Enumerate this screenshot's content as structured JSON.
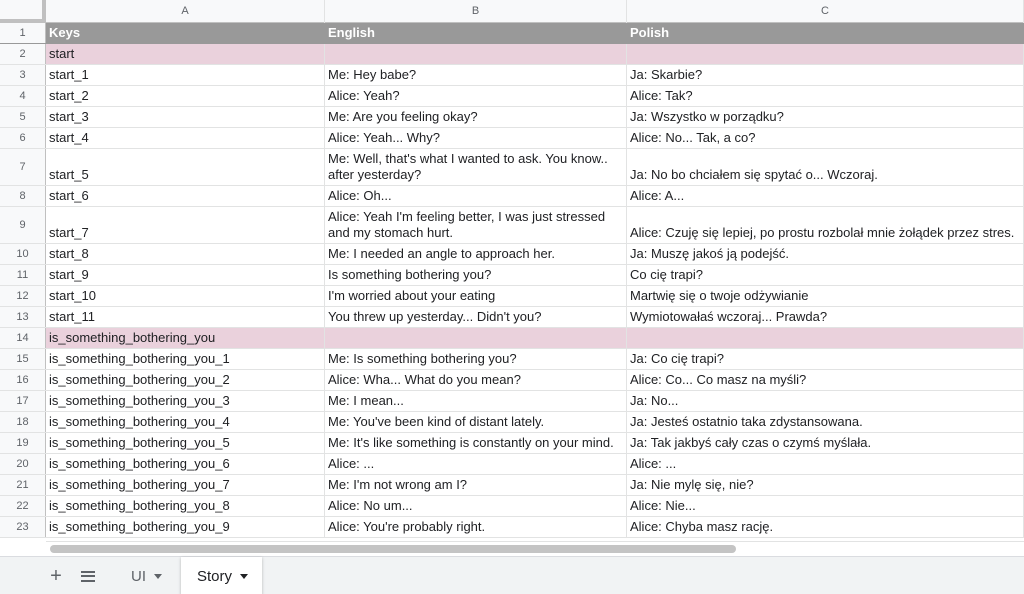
{
  "columns": [
    "A",
    "B",
    "C"
  ],
  "rows": [
    {
      "num": "1",
      "key": "Keys",
      "english": "English",
      "polish": "Polish",
      "type": "header"
    },
    {
      "num": "2",
      "key": "start",
      "english": "",
      "polish": "",
      "type": "section"
    },
    {
      "num": "3",
      "key": "start_1",
      "english": "Me: Hey babe?",
      "polish": "Ja: Skarbie?"
    },
    {
      "num": "4",
      "key": "start_2",
      "english": "Alice: Yeah?",
      "polish": "Alice: Tak?"
    },
    {
      "num": "5",
      "key": "start_3",
      "english": "Me: Are you feeling okay?",
      "polish": "Ja: Wszystko w porządku?"
    },
    {
      "num": "6",
      "key": "start_4",
      "english": "Alice: Yeah... Why?",
      "polish": "Alice: No... Tak, a co?"
    },
    {
      "num": "7",
      "key": "start_5",
      "english": "Me: Well, that's what I wanted to ask. You know.. after yesterday?",
      "polish": "Ja: No bo chciałem się spytać o... Wczoraj.",
      "tall": true
    },
    {
      "num": "8",
      "key": "start_6",
      "english": "Alice: Oh...",
      "polish": "Alice: A..."
    },
    {
      "num": "9",
      "key": "start_7",
      "english": "Alice: Yeah I'm feeling better, I was just stressed and my stomach hurt.",
      "polish": "Alice: Czuję się lepiej, po prostu rozbolał mnie żołądek przez stres.",
      "tall": true
    },
    {
      "num": "10",
      "key": "start_8",
      "english": "Me: I needed an angle to approach her.",
      "polish": "Ja: Muszę jakoś ją podejść."
    },
    {
      "num": "11",
      "key": "start_9",
      "english": "Is something bothering you?",
      "polish": "Co cię trapi?"
    },
    {
      "num": "12",
      "key": "start_10",
      "english": "I'm worried about your eating",
      "polish": "Martwię się o twoje odżywianie"
    },
    {
      "num": "13",
      "key": "start_11",
      "english": "You threw up yesterday... Didn't you?",
      "polish": "Wymiotowałaś wczoraj... Prawda?"
    },
    {
      "num": "14",
      "key": "is_something_bothering_you",
      "english": "",
      "polish": "",
      "type": "section"
    },
    {
      "num": "15",
      "key": "is_something_bothering_you_1",
      "english": "Me: Is something bothering you?",
      "polish": "Ja: Co cię trapi?"
    },
    {
      "num": "16",
      "key": "is_something_bothering_you_2",
      "english": "Alice: Wha... What do you mean?",
      "polish": "Alice: Co... Co masz na myśli?"
    },
    {
      "num": "17",
      "key": "is_something_bothering_you_3",
      "english": "Me: I mean...",
      "polish": "Ja: No..."
    },
    {
      "num": "18",
      "key": "is_something_bothering_you_4",
      "english": "Me: You've been kind of distant lately.",
      "polish": "Ja: Jesteś ostatnio taka zdystansowana."
    },
    {
      "num": "19",
      "key": "is_something_bothering_you_5",
      "english": "Me: It's like something is constantly on your mind.",
      "polish": "Ja: Tak jakbyś cały czas o czymś myślała."
    },
    {
      "num": "20",
      "key": "is_something_bothering_you_6",
      "english": "Alice: ...",
      "polish": "Alice: ..."
    },
    {
      "num": "21",
      "key": "is_something_bothering_you_7",
      "english": "Me: I'm not wrong am I?",
      "polish": "Ja: Nie mylę się, nie?"
    },
    {
      "num": "22",
      "key": "is_something_bothering_you_8",
      "english": "Alice: No um...",
      "polish": "Alice: Nie..."
    },
    {
      "num": "23",
      "key": "is_something_bothering_you_9",
      "english": "Alice: You're probably right.",
      "polish": "Alice: Chyba masz rację."
    }
  ],
  "tabs": {
    "add_icon": "+",
    "sheets": [
      {
        "label": "UI",
        "active": false
      },
      {
        "label": "Story",
        "active": true
      }
    ]
  },
  "colors": {
    "header_bg": "#999999",
    "section_bg": "#ead1dc"
  },
  "icons": [
    "plus-icon",
    "all-sheets-icon",
    "caret-down-icon"
  ]
}
